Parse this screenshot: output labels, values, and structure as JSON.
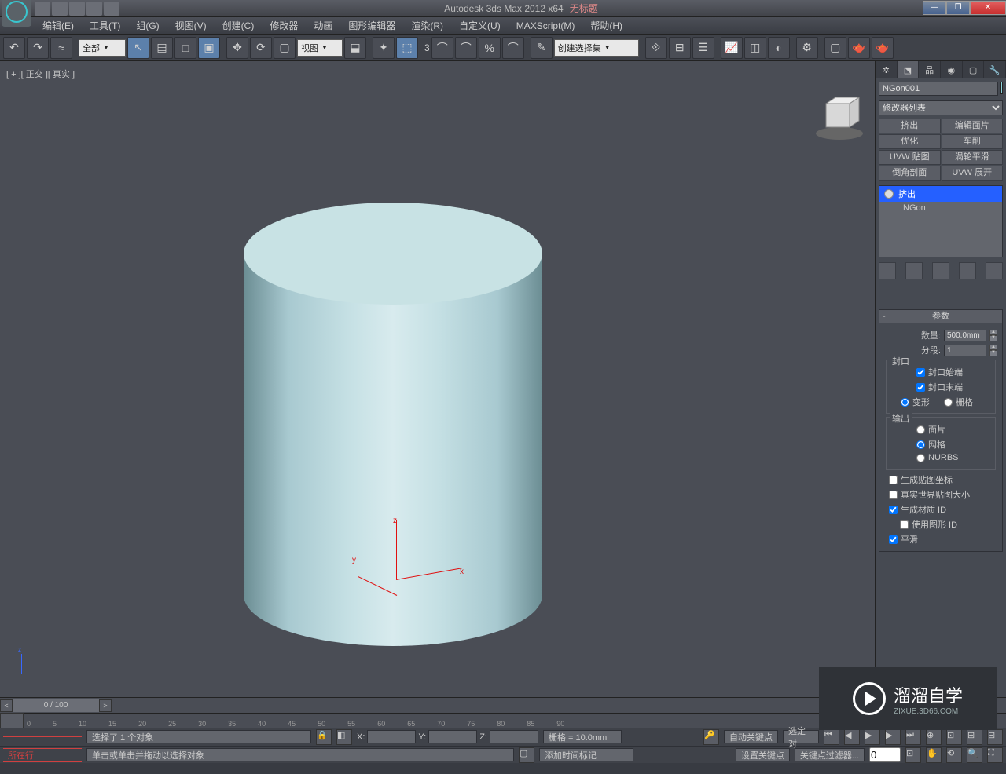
{
  "title": {
    "app": "Autodesk 3ds Max  2012 x64",
    "file": "无标题"
  },
  "menu": [
    "编辑(E)",
    "工具(T)",
    "组(G)",
    "视图(V)",
    "创建(C)",
    "修改器",
    "动画",
    "图形编辑器",
    "渲染(R)",
    "自定义(U)",
    "MAXScript(M)",
    "帮助(H)"
  ],
  "toolbar": {
    "filterAll": "全部",
    "viewType": "视图",
    "snap3": "3",
    "createSet": "创建选择集"
  },
  "viewport": {
    "label": "[ + ][ 正交 ][ 真实 ]",
    "axes": {
      "x": "x",
      "y": "y",
      "z": "z"
    }
  },
  "panel": {
    "objName": "NGon001",
    "modListLabel": "修改器列表",
    "modifiers": [
      "挤出",
      "编辑面片",
      "优化",
      "车削",
      "UVW 贴图",
      "涡轮平滑",
      "倒角剖面",
      "UVW 展开"
    ],
    "stack": [
      {
        "name": "挤出",
        "sel": true,
        "eye": true
      },
      {
        "name": "NGon",
        "sel": false,
        "eye": false
      }
    ],
    "params": {
      "title": "参数",
      "amountLabel": "数量:",
      "amount": "500.0mm",
      "segmentsLabel": "分段:",
      "segments": "1",
      "capGroup": "封口",
      "capStart": "封口始端",
      "capEnd": "封口末端",
      "morph": "变形",
      "grid": "栅格",
      "outputGroup": "输出",
      "patch": "面片",
      "mesh": "网格",
      "nurbs": "NURBS",
      "genMap": "生成贴图坐标",
      "realWorld": "真实世界贴图大小",
      "genMatID": "生成材质 ID",
      "useShapeID": "使用图形 ID",
      "smooth": "平滑"
    }
  },
  "timeline": {
    "frame": "0 / 100",
    "ticks": [
      "0",
      "5",
      "10",
      "15",
      "20",
      "25",
      "30",
      "35",
      "40",
      "45",
      "50",
      "55",
      "60",
      "65",
      "70",
      "75",
      "80",
      "85",
      "90"
    ]
  },
  "status": {
    "selMsg": "选择了 1 个对象",
    "hint": "单击或单击并拖动以选择对象",
    "x": "X:",
    "y": "Y:",
    "z": "Z:",
    "grid": "栅格 = 10.0mm",
    "autoKey": "自动关键点",
    "selBox": "选定对",
    "addTime": "添加时间标记",
    "redLabel": "所在行:",
    "setKey": "设置关键点",
    "keyFilter": "关键点过滤器..."
  },
  "watermark": {
    "brand": "溜溜自学",
    "url": "ZIXUE.3D66.COM"
  }
}
